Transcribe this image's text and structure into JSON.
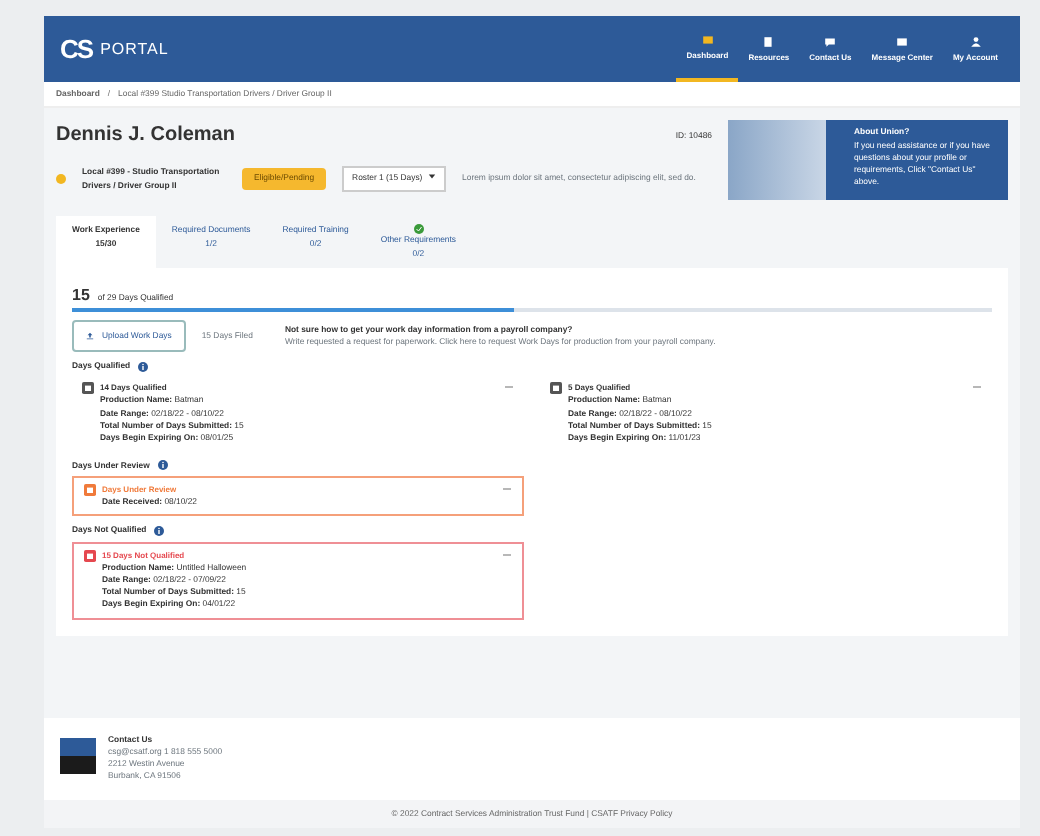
{
  "navbar": {
    "logo_mark": "CS",
    "logo_text": "PORTAL",
    "items": [
      {
        "label": "Dashboard",
        "selected": true
      },
      {
        "label": "Resources",
        "selected": false
      },
      {
        "label": "Contact Us",
        "selected": false
      },
      {
        "label": "Message Center",
        "selected": false
      },
      {
        "label": "My Account",
        "selected": false
      }
    ]
  },
  "breadcrumb": {
    "separator": "/",
    "items": [
      "Dashboard",
      "Local #399 Studio Transportation Drivers / Driver Group II"
    ]
  },
  "profile": {
    "name": "Dennis J. Coleman",
    "member_id": "ID: 10486",
    "union": "Local #399 - Studio Transportation Drivers / Driver Group II",
    "status_badge": "Eligible/Pending",
    "roster": "Roster 1 (15 Days)",
    "note": "Lorem ipsum dolor sit amet, consectetur adipiscing elit, sed do."
  },
  "promo": {
    "title": "About Union?",
    "body": "If you need assistance or if you have questions about your profile or requirements, Click \"Contact Us\" above."
  },
  "tabs": [
    {
      "label": "Work Experience",
      "count": "15/30",
      "selected": true,
      "complete": false
    },
    {
      "label": "Required Documents",
      "count": "1/2",
      "selected": false,
      "complete": false
    },
    {
      "label": "Required Training",
      "count": "0/2",
      "selected": false,
      "complete": false
    },
    {
      "label": "Other Requirements",
      "count": "0/2",
      "selected": false,
      "complete": true
    }
  ],
  "progress": {
    "number": "15",
    "caption": "of 29 Days Qualified",
    "level": 0.48
  },
  "upload": {
    "button": "Upload Work Days",
    "note": "15 Days Filed",
    "help_title": "Not sure how to get your work day information from a payroll company?",
    "help_text": "Write requested a request for paperwork. Click here to request Work Days for production from your payroll company."
  },
  "sections": [
    {
      "title": "Days Qualified",
      "cards": [
        {
          "kind": "qualified",
          "title": "14 Days Qualified",
          "fields": [
            [
              "Production Name:",
              "Batman"
            ],
            [
              "Date Range:",
              "02/18/22 - 08/10/22"
            ],
            [
              "Total Number of Days Submitted:",
              "15"
            ],
            [
              "Days Begin Expiring On:",
              "08/01/25"
            ]
          ]
        },
        {
          "kind": "qualified",
          "title": "5 Days Qualified",
          "fields": [
            [
              "Production Name:",
              "Batman"
            ],
            [
              "Date Range:",
              "02/18/22 - 08/10/22"
            ],
            [
              "Total Number of Days Submitted:",
              "15"
            ],
            [
              "Days Begin Expiring On:",
              "11/01/23"
            ]
          ]
        }
      ]
    },
    {
      "title": "Days Under Review",
      "cards": [
        {
          "kind": "review",
          "title": "Days Under Review",
          "fields": [
            [
              "Date Received:",
              "08/10/22"
            ]
          ]
        }
      ]
    },
    {
      "title": "Days Not Qualified",
      "cards": [
        {
          "kind": "not_qualified",
          "title": "15 Days Not Qualified",
          "fields": [
            [
              "Production Name:",
              "Untitled Halloween"
            ],
            [
              "Date Range:",
              "02/18/22 - 07/09/22"
            ],
            [
              "Total Number of Days Submitted:",
              "15"
            ],
            [
              "Days Begin Expiring On:",
              "04/01/22"
            ]
          ]
        }
      ]
    }
  ],
  "footer": {
    "heading": "Contact Us",
    "lines": [
      "csg@csatf.org  1 818 555 5000",
      "2212 Westin Avenue",
      "Burbank, CA 91506"
    ],
    "copyright": "© 2022 Contract Services Administration Trust Fund  |  CSATF Privacy Policy"
  }
}
